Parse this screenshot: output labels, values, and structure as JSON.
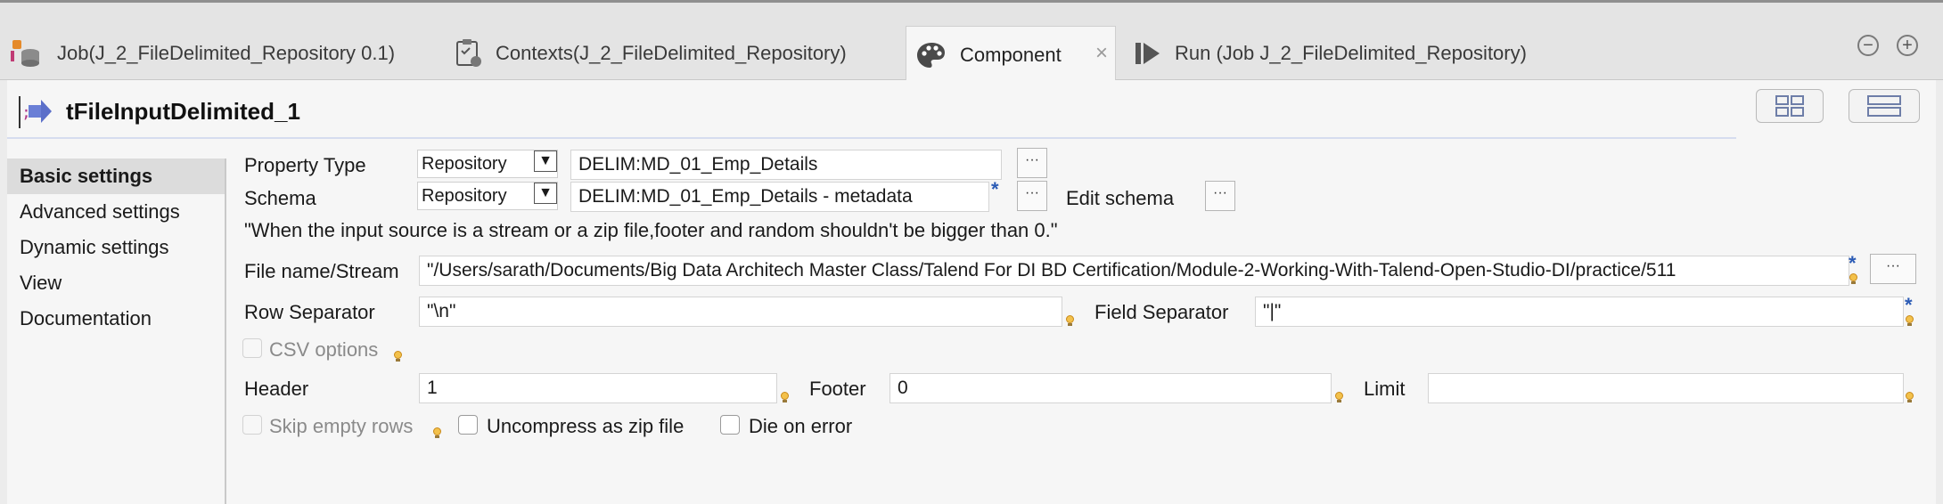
{
  "tabs": [
    {
      "label": "Job(J_2_FileDelimited_Repository 0.1)",
      "icon": "job-icon"
    },
    {
      "label": "Contexts(J_2_FileDelimited_Repository)",
      "icon": "contexts-icon"
    },
    {
      "label": "Component",
      "icon": "palette-icon",
      "active": true
    },
    {
      "label": "Run (Job J_2_FileDelimited_Repository)",
      "icon": "run-icon"
    }
  ],
  "tab_close": "×",
  "window_controls": {
    "minimize": "−",
    "maximize": "+"
  },
  "component": {
    "title": "tFileInputDelimited_1"
  },
  "sidebar": {
    "items": [
      {
        "label": "Basic settings",
        "active": true
      },
      {
        "label": "Advanced settings"
      },
      {
        "label": "Dynamic settings"
      },
      {
        "label": "View"
      },
      {
        "label": "Documentation"
      }
    ]
  },
  "form": {
    "property_type": {
      "label": "Property Type",
      "combo": "Repository",
      "value": "DELIM:MD_01_Emp_Details"
    },
    "schema": {
      "label": "Schema",
      "combo": "Repository",
      "value": "DELIM:MD_01_Emp_Details - metadata",
      "edit_label": "Edit schema"
    },
    "note": "\"When the input source is a stream or a zip file,footer and random shouldn't be bigger than 0.\"",
    "file_name": {
      "label": "File name/Stream",
      "value": "\"/Users/sarath/Documents/Big Data Architech Master Class/Talend For DI BD Certification/Module-2-Working-With-Talend-Open-Studio-DI/practice/511"
    },
    "row_separator": {
      "label": "Row Separator",
      "value": "\"\\n\""
    },
    "field_separator": {
      "label": "Field Separator",
      "value": "\"|\""
    },
    "csv_options": {
      "label": "CSV options",
      "checked": false,
      "enabled": false
    },
    "header": {
      "label": "Header",
      "value": "1"
    },
    "footer": {
      "label": "Footer",
      "value": "0"
    },
    "limit": {
      "label": "Limit",
      "value": ""
    },
    "skip_empty_rows": {
      "label": "Skip empty rows",
      "checked": false,
      "enabled": false
    },
    "uncompress_zip": {
      "label": "Uncompress as zip file",
      "checked": false
    },
    "die_on_error": {
      "label": "Die on error",
      "checked": false
    }
  },
  "glyphs": {
    "dots": "···",
    "arrow": "▼",
    "star": "*"
  },
  "colors": {
    "accent_star": "#2b5bb5",
    "bulb": "#f3c14b"
  }
}
